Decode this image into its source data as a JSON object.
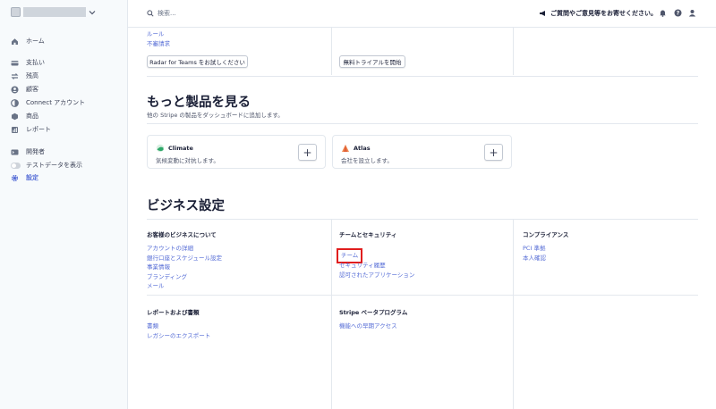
{
  "sidebar": {
    "items": [
      {
        "label": "ホーム",
        "icon": "home-icon"
      },
      {
        "label": "支払い",
        "icon": "payments-icon"
      },
      {
        "label": "残高",
        "icon": "balance-icon"
      },
      {
        "label": "顧客",
        "icon": "customers-icon"
      },
      {
        "label": "Connect アカウント",
        "icon": "connect-icon"
      },
      {
        "label": "商品",
        "icon": "products-icon"
      },
      {
        "label": "レポート",
        "icon": "reports-icon"
      },
      {
        "label": "開発者",
        "icon": "developers-icon"
      },
      {
        "label": "テストデータを表示",
        "icon": "toggle-icon"
      },
      {
        "label": "設定",
        "icon": "gear-icon",
        "active": true
      }
    ]
  },
  "topbar": {
    "search_placeholder": "検索...",
    "feedback": "ご質問やご意見等をお寄せください。"
  },
  "top_section": {
    "links": [
      "ルール",
      "不審請求"
    ],
    "radar_button": "Radar for Teams をお試しください",
    "trial_button": "無料トライアルを開始"
  },
  "more_products": {
    "title": "もっと製品を見る",
    "subtitle": "他の Stripe の製品をダッシュボードに追加します。",
    "cards": [
      {
        "name": "Climate",
        "desc": "気候変動に対抗します。",
        "plus": "+"
      },
      {
        "name": "Atlas",
        "desc": "会社を設立します。",
        "plus": "+"
      }
    ]
  },
  "business_settings": {
    "title": "ビジネス設定",
    "columns": [
      {
        "title": "お客様のビジネスについて",
        "links": [
          "アカウントの詳細",
          "銀行口座とスケジュール設定",
          "事業情報",
          "ブランディング",
          "メール"
        ]
      },
      {
        "title": "チームとセキュリティ",
        "links": [
          "チーム",
          "セキュリティ履歴",
          "認可されたアプリケーション"
        ]
      },
      {
        "title": "コンプライアンス",
        "links": [
          "PCI 準拠",
          "本人確認"
        ]
      },
      {
        "title": "レポートおよび書類",
        "links": [
          "書類",
          "レガシーのエクスポート"
        ]
      },
      {
        "title": "Stripe ベータプログラム",
        "links": [
          "機能への早期アクセス"
        ]
      }
    ]
  },
  "colors": {
    "accent": "#556cd6",
    "highlight": "#e01e1e",
    "sidebar_bg": "#f7fafc"
  }
}
